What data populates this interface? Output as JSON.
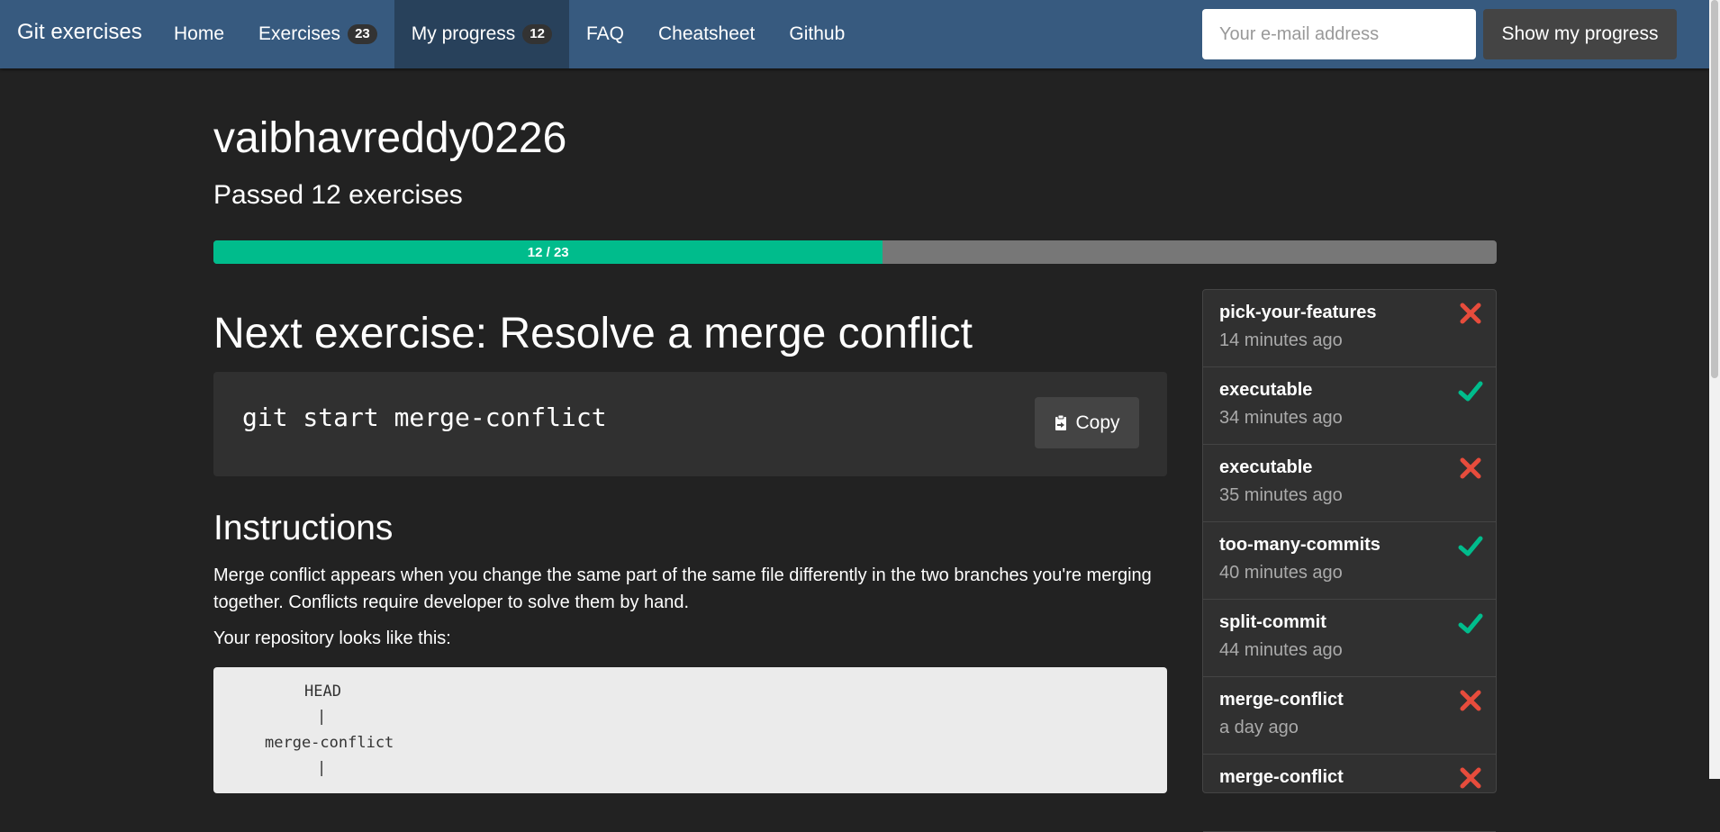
{
  "nav": {
    "brand": "Git exercises",
    "items": [
      {
        "label": "Home"
      },
      {
        "label": "Exercises",
        "badge": "23"
      },
      {
        "label": "My progress",
        "badge": "12",
        "active": true
      },
      {
        "label": "FAQ"
      },
      {
        "label": "Cheatsheet"
      },
      {
        "label": "Github"
      }
    ],
    "email_placeholder": "Your e-mail address",
    "email_value": "",
    "show_button": "Show my progress"
  },
  "profile": {
    "username": "vaibhavreddy0226",
    "passed_text": "Passed 12 exercises",
    "progress_label": "12 / 23",
    "progress_fraction": 0.5217
  },
  "next_exercise": {
    "title": "Next exercise: Resolve a merge conflict",
    "command": "git start merge-conflict",
    "copy_label": "Copy"
  },
  "instructions": {
    "heading": "Instructions",
    "paragraph": "Merge conflict appears when you change the same part of the same file differently in the two branches you're merging together. Conflicts require developer to solve them by hand.",
    "repo_intro": "Your repository looks like this:",
    "diagram": {
      "head": "HEAD",
      "pipe1": "|",
      "branch": "merge-conflict",
      "pipe2": "|"
    }
  },
  "history": [
    {
      "name": "pick-your-features",
      "time": "14 minutes ago",
      "status": "fail"
    },
    {
      "name": "executable",
      "time": "34 minutes ago",
      "status": "pass"
    },
    {
      "name": "executable",
      "time": "35 minutes ago",
      "status": "fail"
    },
    {
      "name": "too-many-commits",
      "time": "40 minutes ago",
      "status": "pass"
    },
    {
      "name": "split-commit",
      "time": "44 minutes ago",
      "status": "pass"
    },
    {
      "name": "merge-conflict",
      "time": "a day ago",
      "status": "fail"
    },
    {
      "name": "merge-conflict",
      "time": "",
      "status": "fail"
    }
  ],
  "colors": {
    "navbar": "#375a7f",
    "success": "#00bc8c",
    "danger": "#e74c3c",
    "background": "#222222"
  }
}
